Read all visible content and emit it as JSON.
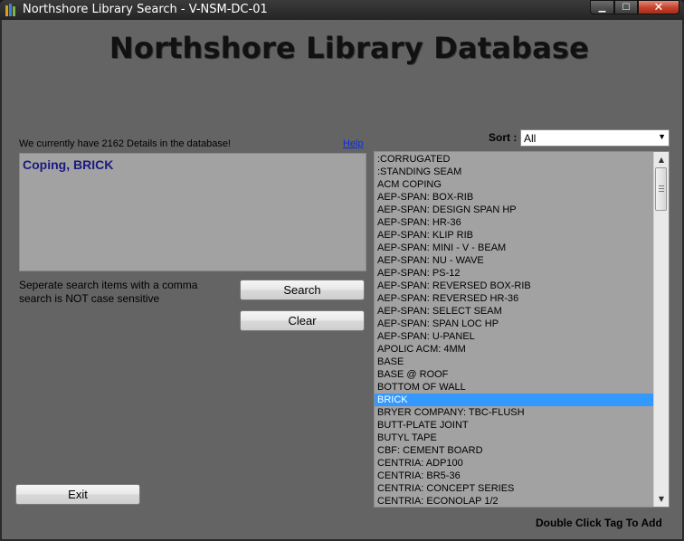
{
  "window": {
    "title": "Northshore Library Search - V-NSM-DC-01",
    "minimize_glyph": "▁",
    "maximize_glyph": "☐",
    "close_glyph": "✕"
  },
  "header": {
    "title": "Northshore Library Database"
  },
  "left_panel": {
    "detail_count_text": "We currently have 2162 Details in the database!",
    "help_link": "Help",
    "search_value": "Coping, BRICK",
    "hint_line1": "Seperate search items with a comma",
    "hint_line2": "search is NOT case sensitive",
    "search_button": "Search",
    "clear_button": "Clear",
    "exit_button": "Exit"
  },
  "sort": {
    "label": "Sort :",
    "selected": "All",
    "arrow": "▼"
  },
  "list": {
    "selected_index": 19,
    "items": [
      ":CORRUGATED",
      ":STANDING SEAM",
      "ACM COPING",
      "AEP-SPAN: BOX-RIB",
      "AEP-SPAN: DESIGN SPAN HP",
      "AEP-SPAN: HR-36",
      "AEP-SPAN: KLIP RIB",
      "AEP-SPAN: MINI - V - BEAM",
      "AEP-SPAN: NU - WAVE",
      "AEP-SPAN: PS-12",
      "AEP-SPAN: REVERSED BOX-RIB",
      "AEP-SPAN: REVERSED HR-36",
      "AEP-SPAN: SELECT SEAM",
      "AEP-SPAN: SPAN LOC HP",
      "AEP-SPAN: U-PANEL",
      "APOLIC ACM: 4MM",
      "BASE",
      "BASE @ ROOF",
      "BOTTOM OF WALL",
      "BRICK",
      "BRYER COMPANY: TBC-FLUSH",
      "BUTT-PLATE JOINT",
      "BUTYL TAPE",
      "CBF: CEMENT BOARD",
      "CENTRIA: ADP100",
      "CENTRIA: BR5-36",
      "CENTRIA: CONCEPT SERIES",
      "CENTRIA: ECONOLAP 1/2"
    ],
    "scroll_up_glyph": "▲",
    "scroll_down_glyph": "▼",
    "thumb_position": 0.0
  },
  "footer": {
    "note": "Double Click Tag To Add"
  },
  "colors": {
    "client_bg": "#646464",
    "panel_bg": "#a2a2a2",
    "selection": "#3399ff",
    "search_text": "#1a1a80",
    "link": "#0b2fe0"
  }
}
